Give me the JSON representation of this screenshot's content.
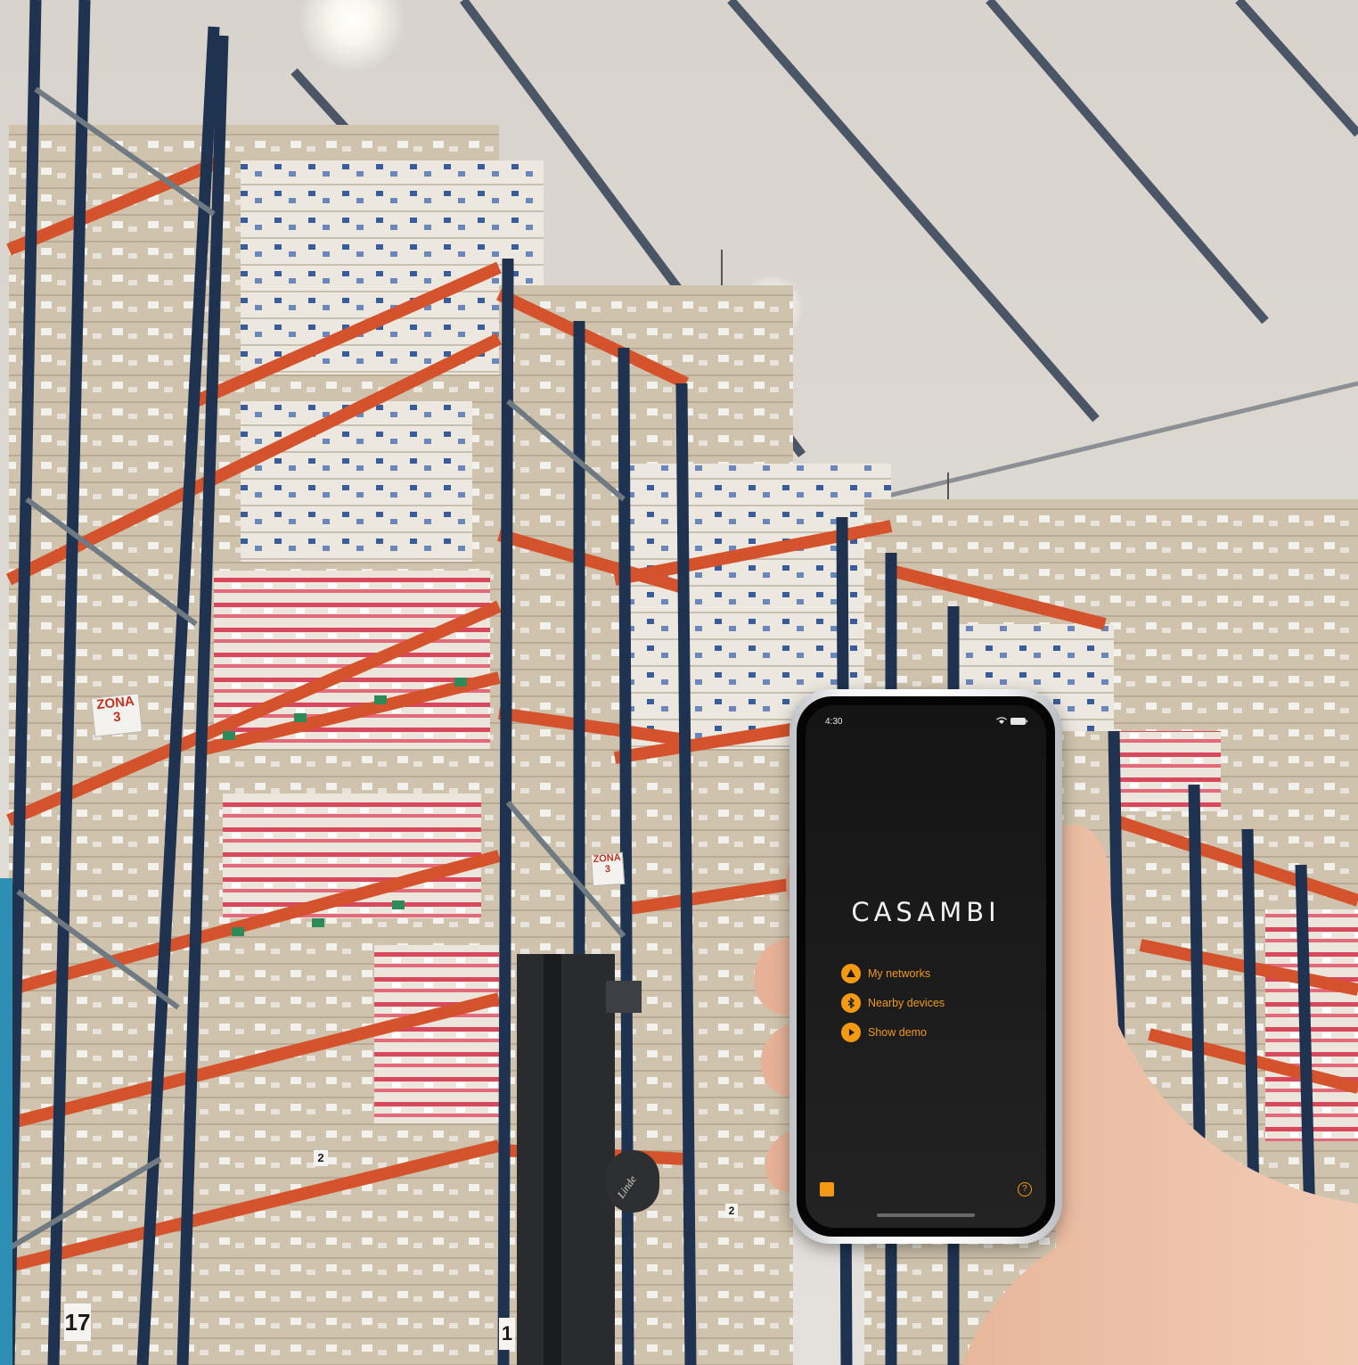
{
  "scene": {
    "rack_signs": [
      {
        "line1": "ZONA",
        "line2": "3"
      },
      {
        "line1": "ZONA",
        "line2": "3"
      }
    ],
    "aisle_numbers": [
      "17",
      "1",
      "2",
      "2"
    ],
    "forklift_brand": "Linde"
  },
  "phone": {
    "status_time": "4:30",
    "brand": "CASAMBI",
    "menu": [
      {
        "label": "My networks",
        "icon": "network-icon"
      },
      {
        "label": "Nearby devices",
        "icon": "bluetooth-icon"
      },
      {
        "label": "Show demo",
        "icon": "play-icon"
      }
    ],
    "bottom_left_icon": "settings-icon",
    "bottom_right_icon": "help-icon",
    "help_glyph": "?"
  },
  "colors": {
    "accent": "#f39a12",
    "screen_bg": "#1a1a1a",
    "rack_orange": "#d4532c",
    "rack_blue": "#1f3350",
    "ceiling": "#ddd9d3",
    "side_strip": "#2d8fb3"
  }
}
